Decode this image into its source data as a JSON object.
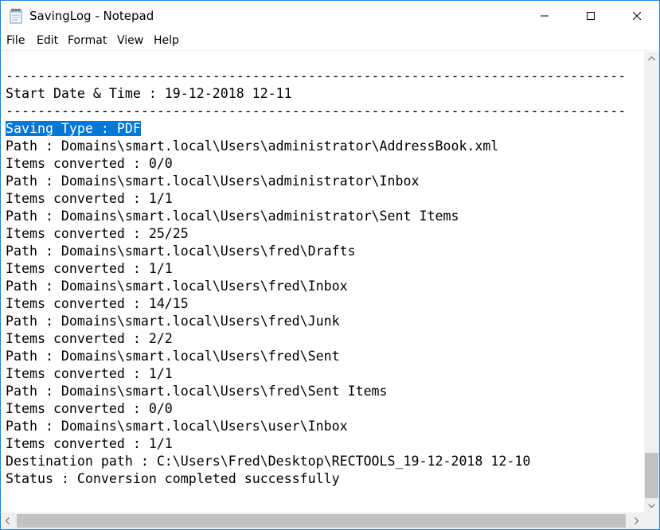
{
  "window": {
    "title": "SavingLog - Notepad",
    "app_icon": "notepad-icon",
    "controls": [
      "minimize-icon",
      "maximize-icon",
      "close-icon"
    ]
  },
  "menu": {
    "file": "File",
    "edit": "Edit",
    "format": "Format",
    "view": "View",
    "help": "Help"
  },
  "editor": {
    "lines": [
      "------------------------------------------------------------------------------",
      "Start Date & Time : 19-12-2018 12-11",
      "------------------------------------------------------------------------------",
      "Saving Type : PDF",
      "Path : Domains\\smart.local\\Users\\administrator\\AddressBook.xml",
      "Items converted : 0/0",
      "Path : Domains\\smart.local\\Users\\administrator\\Inbox",
      "Items converted : 1/1",
      "Path : Domains\\smart.local\\Users\\administrator\\Sent Items",
      "Items converted : 25/25",
      "Path : Domains\\smart.local\\Users\\fred\\Drafts",
      "Items converted : 1/1",
      "Path : Domains\\smart.local\\Users\\fred\\Inbox",
      "Items converted : 14/15",
      "Path : Domains\\smart.local\\Users\\fred\\Junk",
      "Items converted : 2/2",
      "Path : Domains\\smart.local\\Users\\fred\\Sent",
      "Items converted : 1/1",
      "Path : Domains\\smart.local\\Users\\fred\\Sent Items",
      "Items converted : 0/0",
      "Path : Domains\\smart.local\\Users\\user\\Inbox",
      "Items converted : 1/1",
      "Destination path : C:\\Users\\Fred\\Desktop\\RECTOOLS_19-12-2018 12-10",
      "Status : Conversion completed successfully"
    ],
    "selected_line": 3,
    "selection_color": "#0078d7"
  },
  "colors": {
    "border": "#1883d7",
    "scrollbar_track": "#f0f0f0",
    "scrollbar_thumb": "#c2c2c2"
  }
}
